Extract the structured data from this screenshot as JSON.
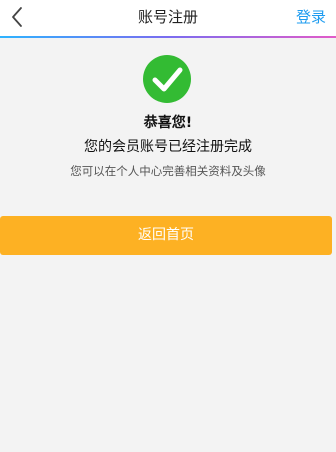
{
  "header": {
    "title": "账号注册",
    "login_label": "登录",
    "back_icon": "chevron-left-icon"
  },
  "success": {
    "icon": "check-circle-icon",
    "icon_color": "#33bb33",
    "congrats": "恭喜您!",
    "message": "您的会员账号已经注册完成",
    "hint": "您可以在个人中心完善相关资料及头像"
  },
  "actions": {
    "home_label": "返回首页",
    "home_color": "#fdb123"
  }
}
